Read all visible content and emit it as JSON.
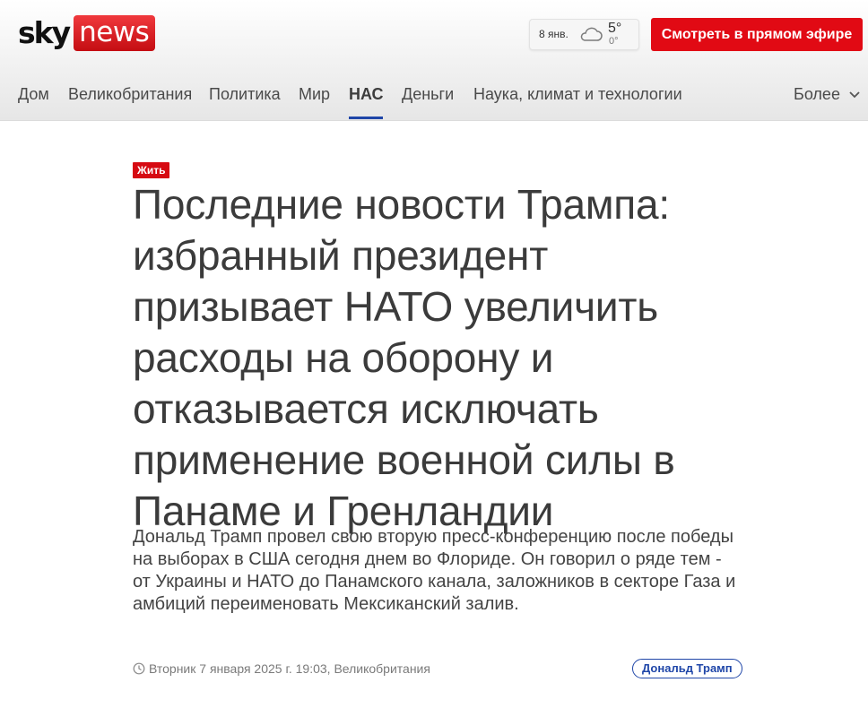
{
  "brand": {
    "sky": "sky",
    "news": "news",
    "accent": "#e10a14"
  },
  "weather": {
    "date": "8 янв.",
    "icon": "cloud-icon",
    "temp": "5°",
    "low": "0°"
  },
  "header": {
    "live_button": "Смотреть в прямом эфире"
  },
  "nav": {
    "items": [
      {
        "label": "Дом"
      },
      {
        "label": "Великобритания"
      },
      {
        "label": "Политика"
      },
      {
        "label": "Мир"
      },
      {
        "label": "НАС",
        "active": true
      },
      {
        "label": "Деньги"
      },
      {
        "label": "Наука, климат и технологии"
      }
    ],
    "more": "Более"
  },
  "article": {
    "badge": "Жить",
    "headline": "Последние новости Трампа: избранный президент призывает НАТО увеличить расходы на оборону и отказывается исключать применение военной силы в Панаме и Гренландии",
    "standfirst": "Дональд Трамп провел свою вторую пресс-конференцию после победы на выборах в США сегодня днем во Флориде. Он говорил о ряде тем - от Украины и НАТО до Панамского канала, заложников в секторе Газа и амбиций переименовать Мексиканский залив.",
    "meta": "Вторник 7 января 2025 г. 19:03, Великобритания",
    "tag": "Дональд Трамп"
  }
}
